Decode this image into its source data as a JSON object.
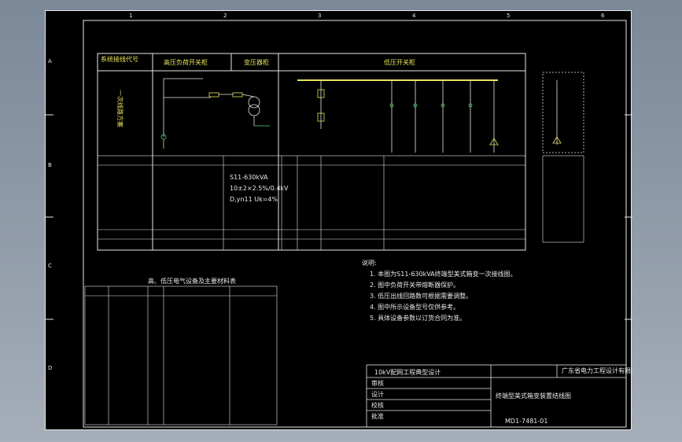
{
  "colors": {
    "background": "#8d98a8",
    "sheet": "#000000",
    "line": "#e8e8e8",
    "yellow": "#e9e45a",
    "green": "#5fd36f",
    "cyan": "#58d6e2",
    "magenta": "#d964d9"
  },
  "title_block": {
    "project": "10kV配网工程典型设计",
    "drawing_title": "终端型美式箱变装置结线图",
    "drawing_number": "MD1-7481-01",
    "company": "广东省电力工程设计有限公司",
    "rows": [
      "审核",
      "设计",
      "校核",
      "批准"
    ]
  },
  "zones": {
    "top": [
      "1",
      "2",
      "3",
      "4",
      "5",
      "6"
    ],
    "side": [
      "A",
      "B",
      "C",
      "D"
    ]
  },
  "headers": {
    "col1": "系统接线代号",
    "col2": "高压负荷开关柜",
    "col3": "变压器柜",
    "col4": "低压开关柜"
  },
  "labels": {
    "left_vertical": "一次线路方案",
    "transformer_block_1": "S11-630kVA",
    "transformer_block_2": "10±2×2.5%/0.4kV",
    "transformer_block_3": "D,yn11 Uk=4%",
    "note_title": "说明:",
    "lower_table_title": "高、低压电气设备及主要材料表"
  },
  "notes": [
    "1. 本图为S11-630kVA终端型美式箱变一次接线图。",
    "2. 图中负荷开关带熔断器保护。",
    "3. 低压出线回路数可根据需要调整。",
    "4. 图中所示设备型号仅供参考。",
    "5. 具体设备参数以订货合同为准。"
  ],
  "icons": [
    "transformer-icon",
    "breaker-icon",
    "fuse-icon",
    "ground-icon"
  ]
}
